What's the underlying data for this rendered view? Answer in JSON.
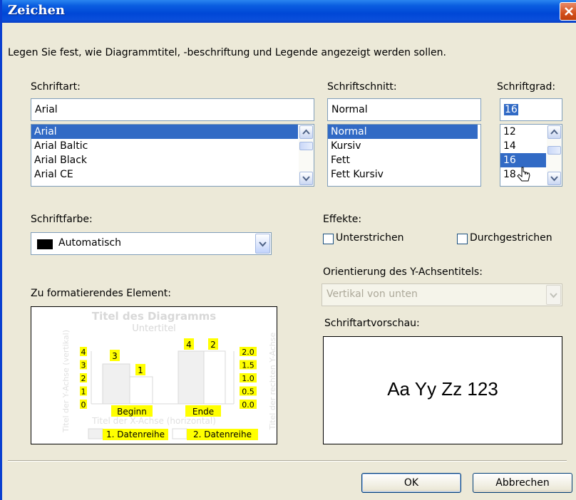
{
  "window": {
    "title": "Zeichen",
    "description": "Legen Sie fest, wie Diagrammtitel, -beschriftung und Legende angezeigt werden sollen."
  },
  "font": {
    "label": "Schriftart:",
    "value": "Arial",
    "items": [
      "Arial",
      "Arial Baltic",
      "Arial Black",
      "Arial CE"
    ],
    "selected": "Arial"
  },
  "style": {
    "label": "Schriftschnitt:",
    "value": "Normal",
    "items": [
      "Normal",
      "Kursiv",
      "Fett",
      "Fett Kursiv"
    ],
    "selected": "Normal"
  },
  "size": {
    "label": "Schriftgrad:",
    "value": "16",
    "items": [
      "12",
      "14",
      "16",
      "18"
    ],
    "selected": "16"
  },
  "color": {
    "label": "Schriftfarbe:",
    "value": "Automatisch",
    "swatch": "#000000"
  },
  "effects": {
    "label": "Effekte:",
    "underline": "Unterstrichen",
    "strikethrough": "Durchgestrichen",
    "underline_checked": false,
    "strikethrough_checked": false
  },
  "orientation": {
    "label": "Orientierung des Y-Achsentitels:",
    "value": "Vertikal von unten"
  },
  "element": {
    "label": "Zu formatierendes Element:",
    "title": "Titel des Diagramms",
    "subtitle": "Untertitel",
    "y_title": "Titel der Y-Achse (vertikal)",
    "y2_title": "Titel der rechten Y-Achse",
    "x_title": "Titel der X-Achse (horizontal)",
    "y_ticks": [
      "4",
      "3",
      "2",
      "1",
      "0"
    ],
    "y2_ticks": [
      "2.0",
      "1.5",
      "1.0",
      "0.5",
      "0.0"
    ],
    "categories": [
      "Beginn",
      "Ende"
    ],
    "bar_labels": [
      "3",
      "1",
      "4",
      "2"
    ],
    "legend": [
      "1. Datenreihe",
      "2. Datenreihe"
    ]
  },
  "preview": {
    "label": "Schriftartvorschau:",
    "text": "Aa Yy Zz 123"
  },
  "buttons": {
    "ok": "OK",
    "cancel": "Abbrechen"
  },
  "colors": {
    "titlebar": "#0047d6",
    "selection": "#316ac5",
    "highlight": "#ffff00"
  }
}
